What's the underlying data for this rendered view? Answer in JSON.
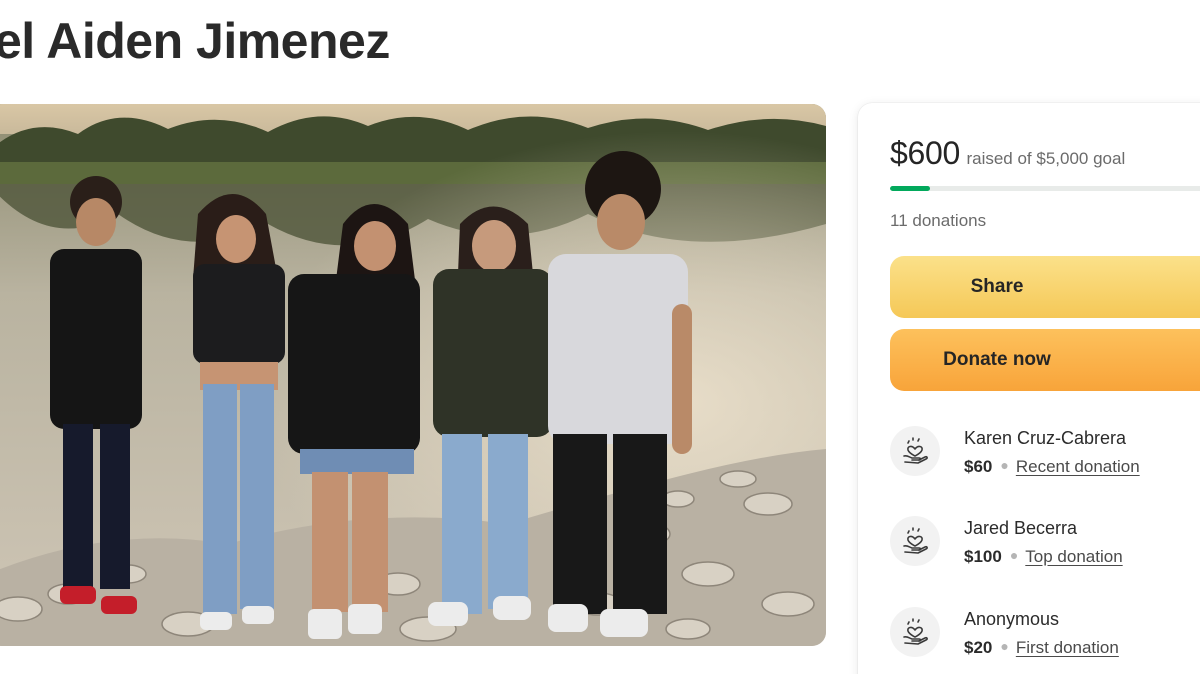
{
  "campaign": {
    "title": "el Aiden Jimenez",
    "photo_icon": "family-photo"
  },
  "card": {
    "amount_raised": "$600",
    "goal_text": "raised of $5,000 goal",
    "progress_fraction": 0.12,
    "progress_color": "#02a95c",
    "donation_count": "11 donations",
    "share_label": "Share",
    "donate_label": "Donate now",
    "share_color": "#f5c857",
    "donate_color": "#f8a43a",
    "donor_icon": "heart-hand-icon",
    "donors": [
      {
        "name": "Karen Cruz-Cabrera",
        "amount": "$60",
        "tag": "Recent donation"
      },
      {
        "name": "Jared Becerra",
        "amount": "$100",
        "tag": "Top donation"
      },
      {
        "name": "Anonymous",
        "amount": "$20",
        "tag": "First donation"
      }
    ]
  }
}
